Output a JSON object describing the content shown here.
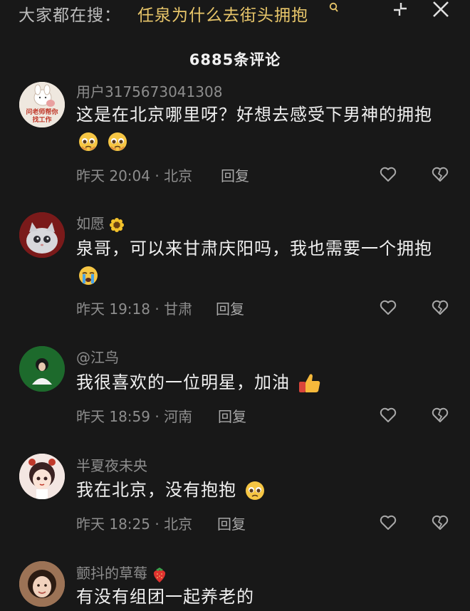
{
  "topbar": {
    "search_prefix": "大家都在搜：",
    "search_query": "任泉为什么去街头拥抱",
    "icons": [
      "search-icon",
      "collapse-icon",
      "close-icon"
    ]
  },
  "comment_count": "6885条评论",
  "comments": [
    {
      "username": "用户3175673041308",
      "text": "这是在北京哪里呀？好想去感受下男神的拥抱",
      "emojis": [
        "pleading-face-emoji",
        "pleading-face-emoji"
      ],
      "time": "昨天 20:04",
      "location": "北京",
      "meta": "昨天 20:04 · 北京",
      "reply_label": "回复",
      "avatar_text": "问老师帮你找工作"
    },
    {
      "username": "如愿",
      "username_emoji": "sunflower-emoji",
      "text": "泉哥，可以来甘肃庆阳吗，我也需要一个拥抱",
      "emojis": [
        "crying-face-emoji"
      ],
      "time": "昨天 19:18",
      "location": "甘肃",
      "meta": "昨天 19:18 · 甘肃",
      "reply_label": "回复"
    },
    {
      "username": "@江鸟",
      "text": "我很喜欢的一位明星，加油",
      "emojis": [
        "thumbs-up-emoji"
      ],
      "time": "昨天 18:59",
      "location": "河南",
      "meta": "昨天 18:59 · 河南",
      "reply_label": "回复"
    },
    {
      "username": "半夏夜未央",
      "text": "我在北京，没有抱抱",
      "emojis": [
        "pleading-face-emoji"
      ],
      "time": "昨天 18:25",
      "location": "北京",
      "meta": "昨天 18:25 · 北京",
      "reply_label": "回复"
    },
    {
      "username": "颤抖的草莓",
      "username_emoji": "strawberry-emoji",
      "text": "有没有组团一起养老的"
    }
  ],
  "colors": {
    "background": "#181818",
    "search_query": "#e8c66a",
    "secondary_text": "#8d8d8d"
  }
}
